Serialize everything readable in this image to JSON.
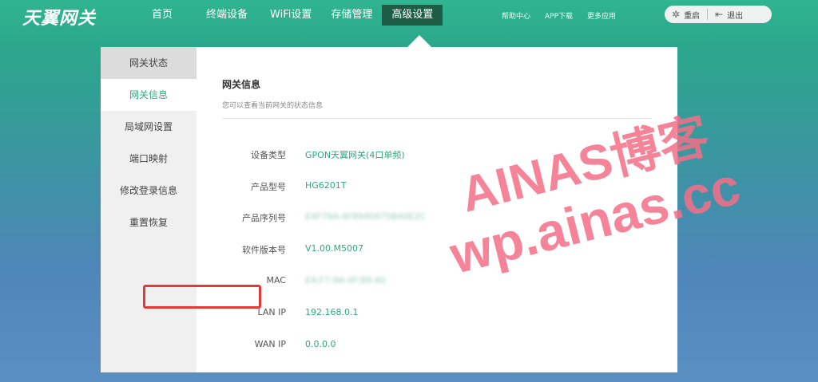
{
  "logo": "天翼网关",
  "nav": {
    "items": [
      {
        "label": "首页"
      },
      {
        "label": "终端设备"
      },
      {
        "label": "WiFi设置"
      },
      {
        "label": "存储管理"
      },
      {
        "label": "高级设置",
        "active": true
      }
    ]
  },
  "utilities": {
    "help": "帮助中心",
    "app": "APP下载",
    "more": "更多应用",
    "restart": "重启",
    "logout": "退出"
  },
  "sidebar": {
    "items": [
      {
        "label": "网关状态"
      },
      {
        "label": "网关信息",
        "active": true
      },
      {
        "label": "局域网设置"
      },
      {
        "label": "端口映射"
      },
      {
        "label": "修改登录信息"
      },
      {
        "label": "重置恢复"
      }
    ]
  },
  "main": {
    "title": "网关信息",
    "subtitle": "您可以查看当前网关的状态信息",
    "rows": [
      {
        "label": "设备类型",
        "value": "GPON天翼网关(4口单频)"
      },
      {
        "label": "产品型号",
        "value": "HG6201T"
      },
      {
        "label": "产品序列号",
        "value": "E4F79A-4F8940475B40E2C"
      },
      {
        "label": "软件版本号",
        "value": "V1.00.M5007"
      },
      {
        "label": "MAC",
        "value": "E4:F7:9A:4F:89:40"
      },
      {
        "label": "LAN IP",
        "value": "192.168.0.1"
      },
      {
        "label": "WAN IP",
        "value": "0.0.0.0"
      }
    ]
  },
  "watermark": {
    "line1": "AINAS博客",
    "line2": "wp.ainas.cc"
  },
  "colors": {
    "accent": "#2eaa80",
    "nav_active": "#1e5d45",
    "highlight_border": "#e53935",
    "watermark": "#f56e87"
  },
  "icons": {
    "restart": "spinner-icon",
    "logout": "logout-icon"
  }
}
